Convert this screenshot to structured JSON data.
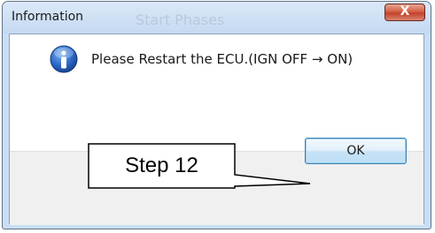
{
  "dialog": {
    "title": "Information",
    "background_title": "Start Phases",
    "close_symbol": "X",
    "icon": "info-icon",
    "message": "Please Restart the ECU.(IGN OFF → ON)",
    "ok_label": "OK"
  },
  "annotation": {
    "text": "Step 12"
  },
  "colors": {
    "info_icon": "#1f5fbf",
    "ok_border": "#3c7fb1",
    "close_button": "#c3412a"
  }
}
